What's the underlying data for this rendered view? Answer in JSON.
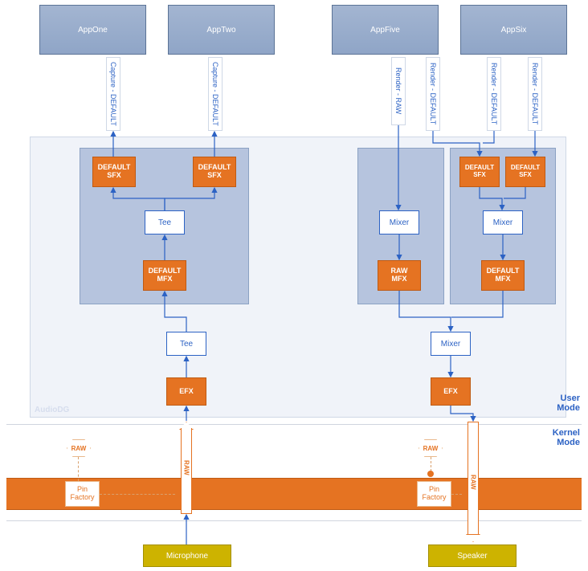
{
  "apps": {
    "one": "AppOne",
    "two": "AppTwo",
    "five": "AppFive",
    "six": "AppSix"
  },
  "connectors": {
    "captureDefault": "Capture - DEFAULT",
    "renderRaw": "Render - RAW",
    "renderDefault": "Render - DEFAULT"
  },
  "boxes": {
    "defaultSfx": "DEFAULT\nSFX",
    "defaultMfx": "DEFAULT\nMFX",
    "rawMfx": "RAW\nMFX",
    "tee": "Tee",
    "mixer": "Mixer",
    "efx": "EFX",
    "raw": "RAW",
    "pinFactory": "Pin\nFactory",
    "microphone": "Microphone",
    "speaker": "Speaker"
  },
  "labels": {
    "audioDg": "AudioDG",
    "userMode": "User\nMode",
    "kernelMode": "Kernel\nMode"
  }
}
